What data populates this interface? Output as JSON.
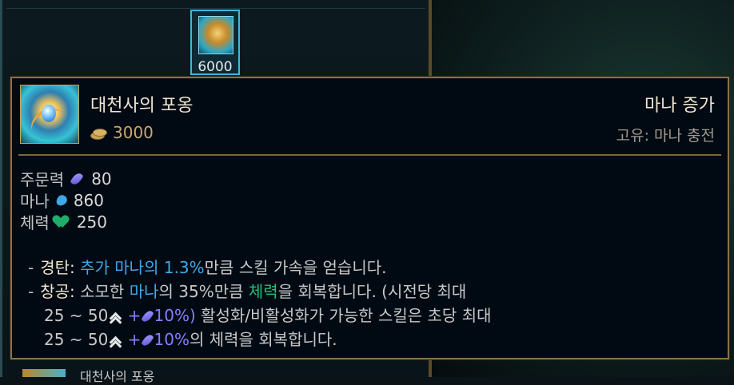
{
  "shop": {
    "item_price": "6000",
    "bottom_item_text": "대천사의 포옹"
  },
  "tooltip": {
    "item_name": "대천사의 포옹",
    "cost": "3000",
    "tag": "마나 증가",
    "unique": "고유: 마나 충전",
    "stats": [
      {
        "label": "주문력",
        "icon": "ability-power-icon",
        "value": "80"
      },
      {
        "label": "마나",
        "icon": "mana-icon",
        "value": "860"
      },
      {
        "label": "체력",
        "icon": "health-icon",
        "value": "250"
      }
    ],
    "passives": {
      "p1_dash": "-",
      "p1_name": "경탄:",
      "p1_blue": "추가 마나의 1.3%",
      "p1_rest": "만큼 스킬 가속을 얻습니다.",
      "p2_dash": "-",
      "p2_name": "창공:",
      "p2_a": "소모한",
      "p2_mana": "마나",
      "p2_b": "의 35%만큼",
      "p2_hp": "체력",
      "p2_c": "을 회복합니다. (시전당 최대",
      "p2_l2_a": "25 ~ 50",
      "p2_l2_plus": "+",
      "p2_l2_pct": "10%)",
      "p2_l2_rest": " 활성화/비활성화가 가능한 스킬은 초당 최대",
      "p2_l3_a": "25 ~ 50",
      "p2_l3_plus": "+",
      "p2_l3_pct": "10%",
      "p2_l3_rest": "의 체력을 회복합니다."
    }
  },
  "colors": {
    "border_gold": "#8a7246",
    "gold_text": "#c8aa6e",
    "mana_blue": "#3fa7e8",
    "health_green": "#1fc07a",
    "ap_purple": "#8a7cff"
  }
}
